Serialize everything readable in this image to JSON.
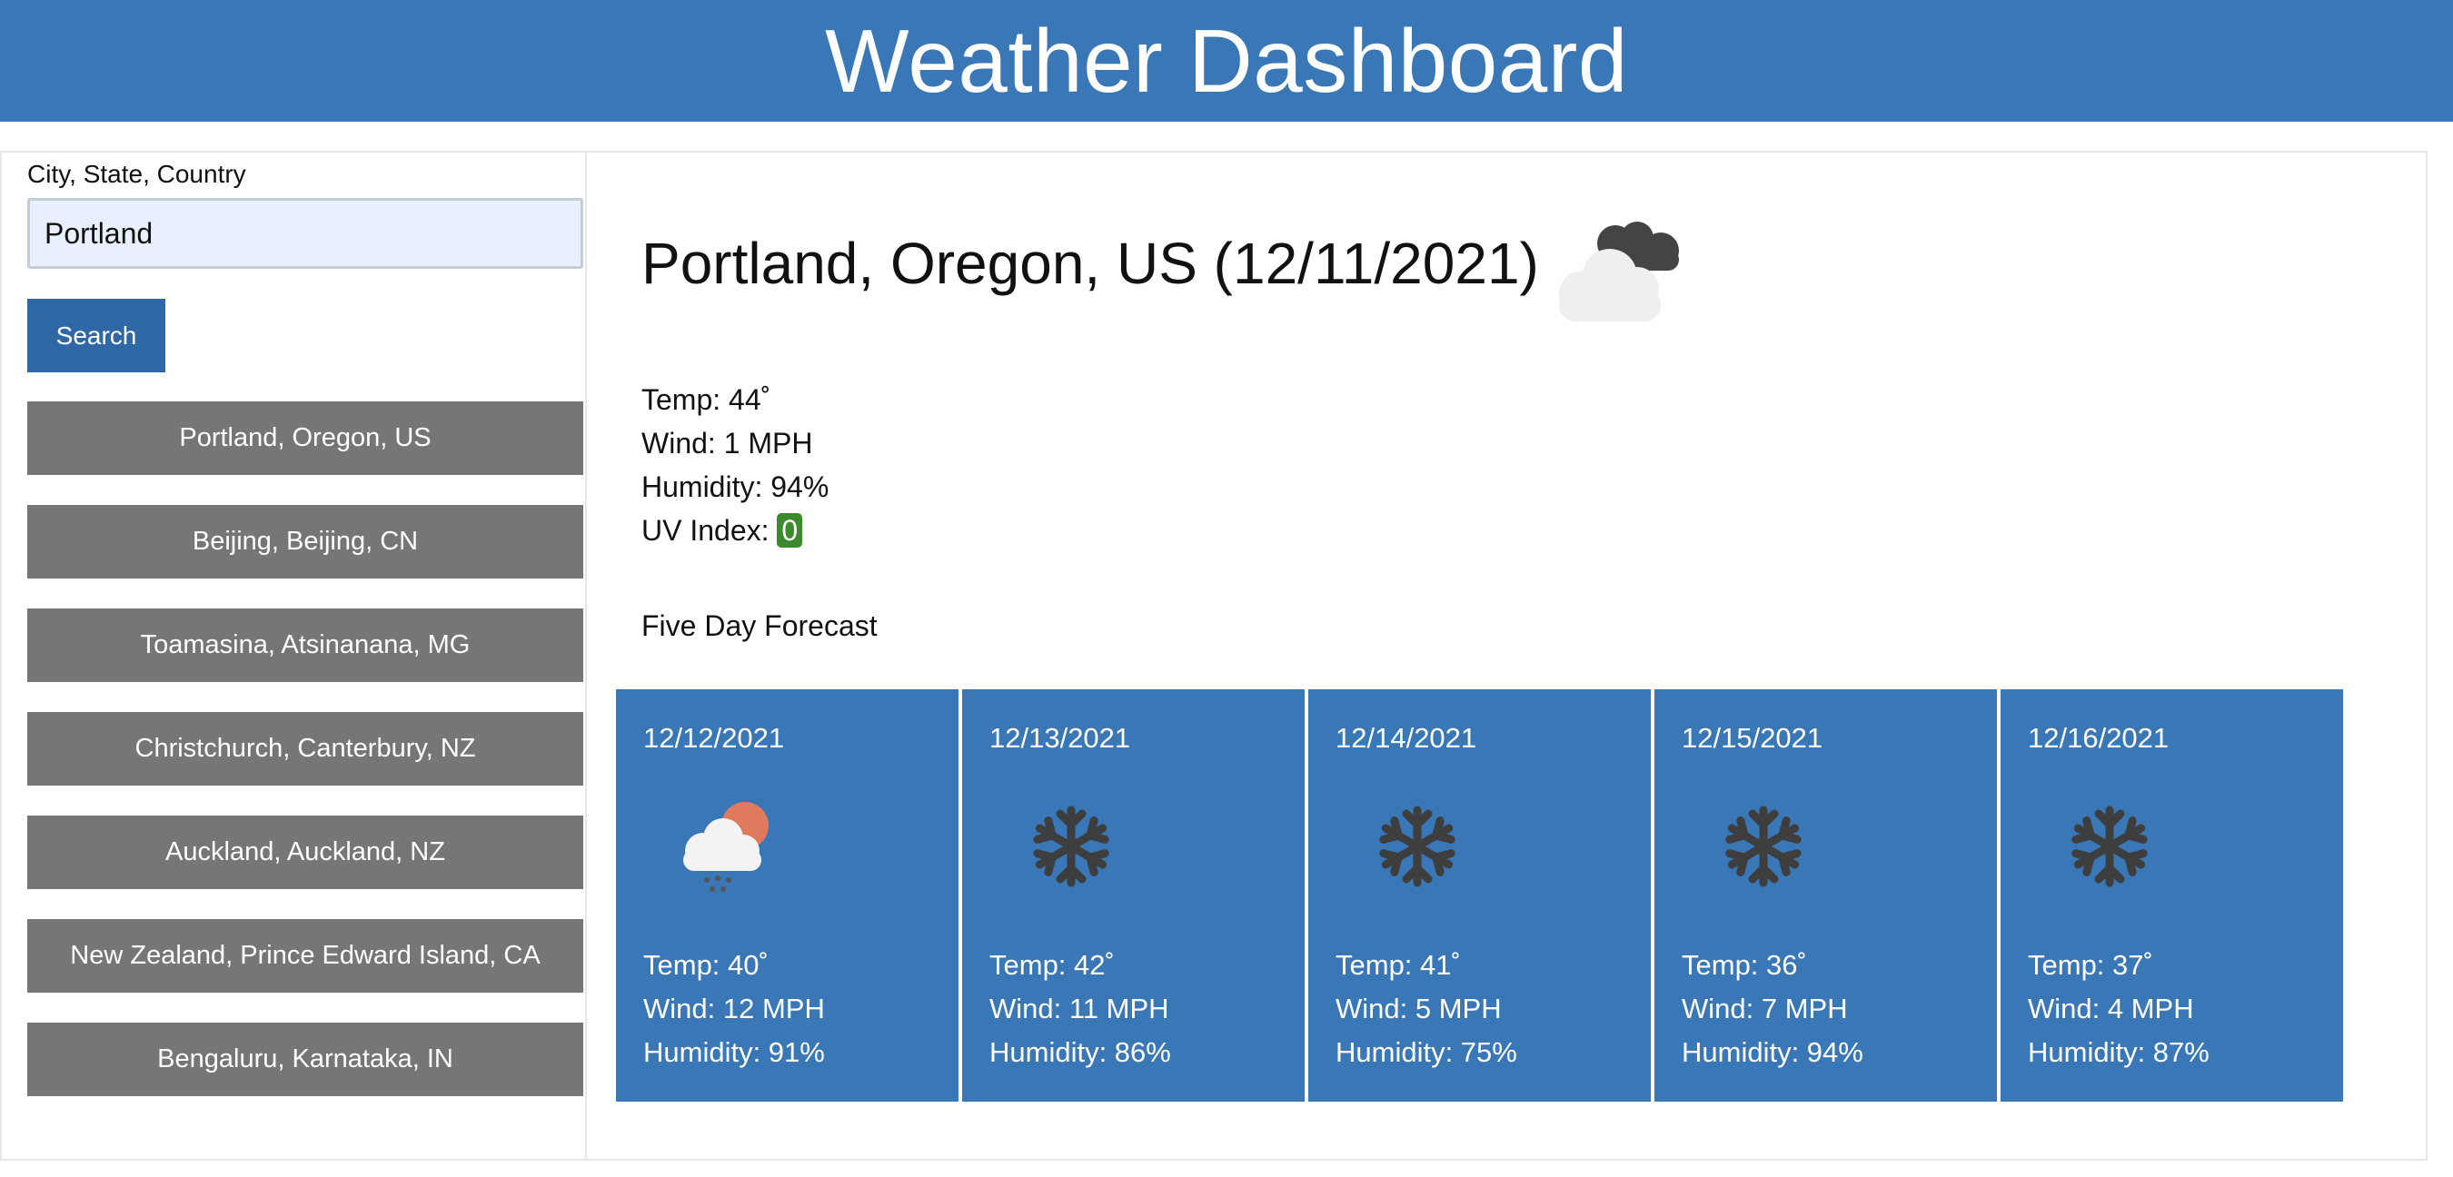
{
  "header": {
    "title": "Weather Dashboard"
  },
  "sidebar": {
    "search_label": "City, State, Country",
    "search_value": "Portland",
    "search_button": "Search",
    "history": [
      "Portland, Oregon, US",
      "Beijing, Beijing, CN",
      "Toamasina, Atsinanana, MG",
      "Christchurch, Canterbury, NZ",
      "Auckland, Auckland, NZ",
      "New Zealand, Prince Edward Island, CA",
      "Bengaluru, Karnataka, IN"
    ]
  },
  "current": {
    "title": "Portland, Oregon, US (12/11/2021)",
    "icon": "cloud-icon",
    "temp": "Temp: 44˚",
    "wind": "Wind: 1 MPH",
    "humidity": "Humidity: 94%",
    "uv_label": "UV Index:",
    "uv_value": "0",
    "uv_color": "#3b8b2e"
  },
  "forecast": {
    "heading": "Five Day Forecast",
    "days": [
      {
        "date": "12/12/2021",
        "icon": "rain-sun-icon",
        "temp": "Temp: 40˚",
        "wind": "Wind: 12 MPH",
        "humidity": "Humidity: 91%"
      },
      {
        "date": "12/13/2021",
        "icon": "snowflake-icon",
        "temp": "Temp: 42˚",
        "wind": "Wind: 11 MPH",
        "humidity": "Humidity: 86%"
      },
      {
        "date": "12/14/2021",
        "icon": "snowflake-icon",
        "temp": "Temp: 41˚",
        "wind": "Wind: 5 MPH",
        "humidity": "Humidity: 75%"
      },
      {
        "date": "12/15/2021",
        "icon": "snowflake-icon",
        "temp": "Temp: 36˚",
        "wind": "Wind: 7 MPH",
        "humidity": "Humidity: 94%"
      },
      {
        "date": "12/16/2021",
        "icon": "snowflake-icon",
        "temp": "Temp: 37˚",
        "wind": "Wind: 4 MPH",
        "humidity": "Humidity: 87%"
      }
    ]
  },
  "colors": {
    "header": "#3a77b7",
    "search_button": "#2f68a4",
    "history_button": "#767676",
    "forecast_card": "#3a77b7"
  }
}
